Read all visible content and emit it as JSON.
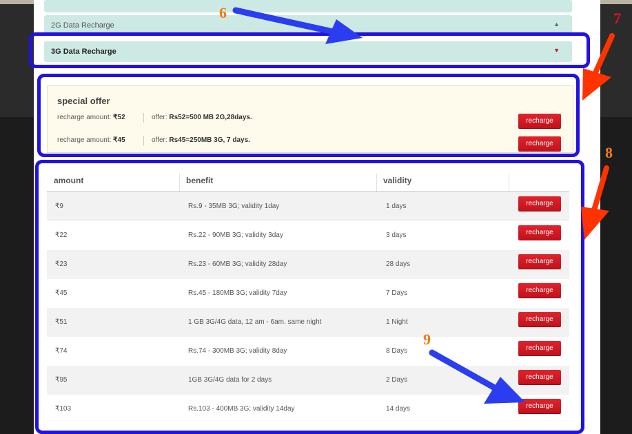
{
  "accordion": {
    "top_label": "",
    "data_2g_label": "2G Data Recharge",
    "data_3g_label": "3G Data Recharge"
  },
  "special_offer": {
    "title": "special offer",
    "amount_prefix": "recharge amount:",
    "offer_prefix": "offer:",
    "rows": [
      {
        "amount": "₹52",
        "offer": "Rs52=500 MB 2G,28days.",
        "button": "recharge"
      },
      {
        "amount": "₹45",
        "offer": "Rs45=250MB 3G, 7 days.",
        "button": "recharge"
      }
    ]
  },
  "table": {
    "headers": {
      "amount": "amount",
      "benefit": "benefit",
      "validity": "validity"
    },
    "rows": [
      {
        "amount": "₹9",
        "benefit": "Rs.9 - 35MB 3G; validity 1day",
        "validity": "1 days",
        "button": "recharge"
      },
      {
        "amount": "₹22",
        "benefit": "Rs.22 - 90MB 3G; validity 3day",
        "validity": "3 days",
        "button": "recharge"
      },
      {
        "amount": "₹23",
        "benefit": "Rs.23 - 60MB 3G; validity 28day",
        "validity": "28 days",
        "button": "recharge"
      },
      {
        "amount": "₹45",
        "benefit": "Rs.45 - 180MB 3G; validity 7day",
        "validity": "7 Days",
        "button": "recharge"
      },
      {
        "amount": "₹51",
        "benefit": "1 GB 3G/4G data, 12 am - 6am. same night",
        "validity": "1 Night",
        "button": "recharge"
      },
      {
        "amount": "₹74",
        "benefit": "Rs.74 - 300MB 3G; validity 8day",
        "validity": "8 Days",
        "button": "recharge"
      },
      {
        "amount": "₹95",
        "benefit": "1GB 3G/4G data for 2 days",
        "validity": "2 Days",
        "button": "recharge"
      },
      {
        "amount": "₹103",
        "benefit": "Rs.103 - 400MB 3G; validity 14day",
        "validity": "14 days",
        "button": "recharge"
      }
    ]
  },
  "annotations": {
    "n6": "6",
    "n7": "7",
    "n8": "8",
    "n9": "9",
    "box_color": "#2212e0",
    "blue_arrow_color": "#2a3df0",
    "red_arrow_color": "#ff3300",
    "orange_number_color": "#f07a12",
    "red_number_color": "#e0141c"
  }
}
